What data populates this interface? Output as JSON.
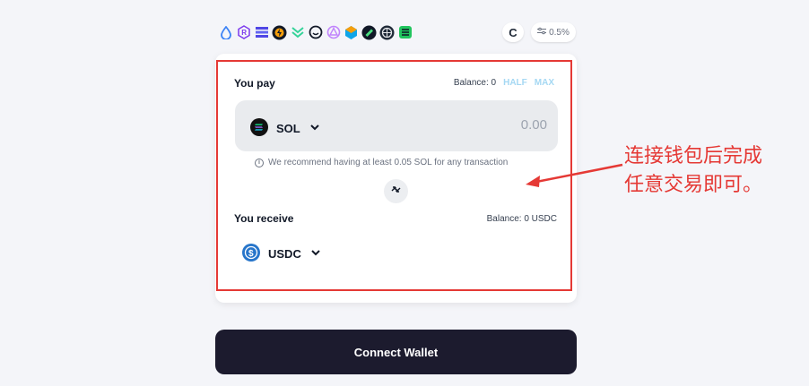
{
  "dex_icons": [
    {
      "name": "drop-icon",
      "color": "#3b82f6"
    },
    {
      "name": "raydium-icon",
      "color": "#7c3aed"
    },
    {
      "name": "stripes-icon",
      "color": "#4f46e5"
    },
    {
      "name": "bolt-coin-icon",
      "color": "#1f2937"
    },
    {
      "name": "chevrons-icon",
      "color": "#34d399"
    },
    {
      "name": "smile-face-icon",
      "color": "#111827"
    },
    {
      "name": "triangle-circle-icon",
      "color": "#c084fc"
    },
    {
      "name": "cube-icon",
      "color": "#0ea5e9"
    },
    {
      "name": "ring-coin-icon",
      "color": "#111827"
    },
    {
      "name": "globe-icon",
      "color": "#1f2937"
    },
    {
      "name": "green-square-icon",
      "color": "#22c55e"
    }
  ],
  "toolbar": {
    "refresh_glyph": "C",
    "slippage": "0.5%"
  },
  "pay": {
    "label": "You pay",
    "balance": "Balance: 0",
    "half": "HALF",
    "max": "MAX",
    "token": "SOL",
    "amount_placeholder": "0.00",
    "hint": "We recommend having at least 0.05 SOL for any transaction"
  },
  "receive": {
    "label": "You receive",
    "balance": "Balance: 0 USDC",
    "token": "USDC"
  },
  "connect_label": "Connect Wallet",
  "annotation": {
    "line1": "连接钱包后完成",
    "line2": "任意交易即可。"
  },
  "colors": {
    "accent_red": "#e53935",
    "button_dark": "#1c1b2e",
    "link_blue": "#a5d8f3"
  }
}
